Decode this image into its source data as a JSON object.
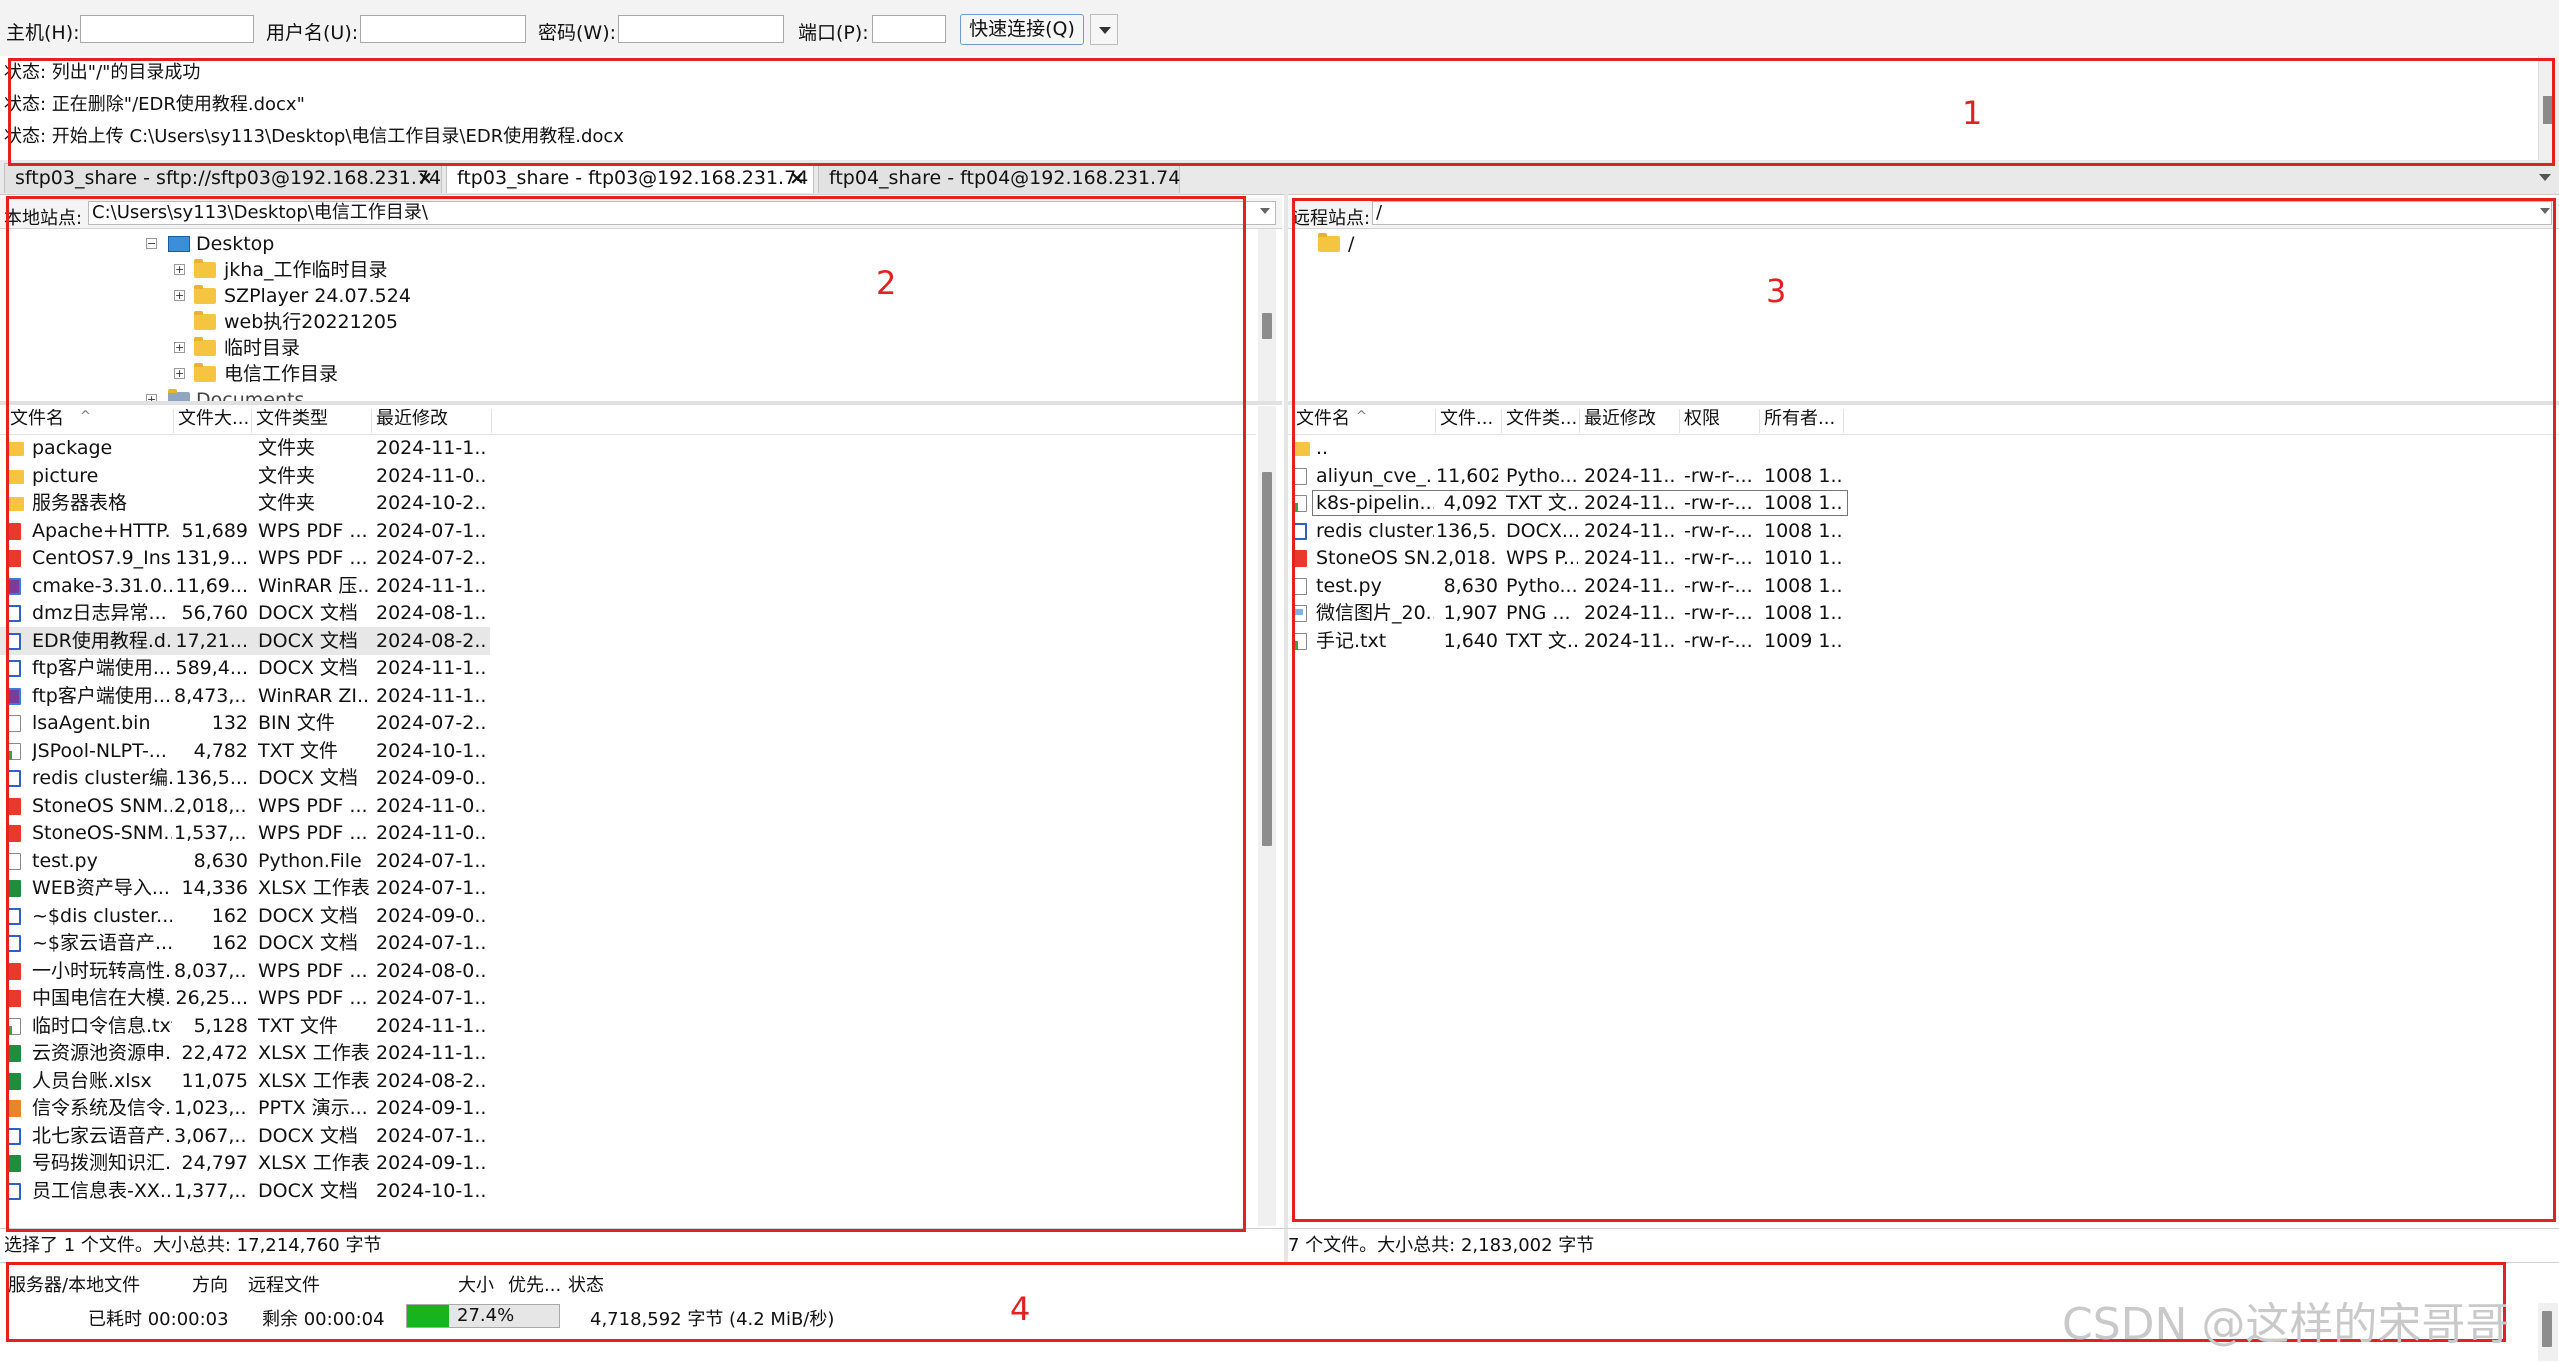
{
  "quickconnect": {
    "host_label": "主机(H):",
    "user_label": "用户名(U):",
    "password_label": "密码(W):",
    "port_label": "端口(P):",
    "connect_button": "快速连接(Q)",
    "host_value": "",
    "user_value": "",
    "password_value": "",
    "port_value": ""
  },
  "log": [
    "状态: 列出\"/\"的目录成功",
    "状态: 正在删除\"/EDR使用教程.docx\"",
    "状态: 开始上传 C:\\Users\\sy113\\Desktop\\电信工作目录\\EDR使用教程.docx"
  ],
  "tabs": [
    {
      "label": "sftp03_share - sftp://sftp03@192.168.231.74"
    },
    {
      "label": "ftp03_share - ftp03@192.168.231.74"
    },
    {
      "label": "ftp04_share - ftp04@192.168.231.74"
    }
  ],
  "local": {
    "path_label": "本地站点:",
    "path": "C:\\Users\\sy113\\Desktop\\电信工作目录\\",
    "tree": [
      {
        "label": "Desktop",
        "icon": "desktop-icon",
        "expander": "−"
      },
      {
        "label": "jkha_工作临时目录",
        "icon": "folder-icon",
        "expander": "+"
      },
      {
        "label": "SZPlayer 24.07.524",
        "icon": "folder-icon",
        "expander": "+"
      },
      {
        "label": "web执行20221205",
        "icon": "folder-icon",
        "expander": ""
      },
      {
        "label": "临时目录",
        "icon": "folder-icon",
        "expander": "+"
      },
      {
        "label": "电信工作目录",
        "icon": "folder-icon",
        "expander": "+"
      },
      {
        "label": "Documents",
        "icon": "folder-icon",
        "expander": "+"
      }
    ],
    "columns": [
      "文件名",
      "文件大...",
      "文件类型",
      "最近修改"
    ],
    "files": [
      {
        "name": "package",
        "size": "",
        "type": "文件夹",
        "modified": "2024-11-1...",
        "icon": "folder"
      },
      {
        "name": "picture",
        "size": "",
        "type": "文件夹",
        "modified": "2024-11-0...",
        "icon": "folder"
      },
      {
        "name": "服务器表格",
        "size": "",
        "type": "文件夹",
        "modified": "2024-10-2...",
        "icon": "folder"
      },
      {
        "name": "Apache+HTTP...",
        "size": "51,689",
        "type": "WPS PDF ...",
        "modified": "2024-07-1...",
        "icon": "pdf"
      },
      {
        "name": "CentOS7.9_Ins...",
        "size": "131,9...",
        "type": "WPS PDF ...",
        "modified": "2024-07-2...",
        "icon": "pdf"
      },
      {
        "name": "cmake-3.31.0....",
        "size": "11,69...",
        "type": "WinRAR 压...",
        "modified": "2024-11-1...",
        "icon": "rar"
      },
      {
        "name": "dmz日志异常...",
        "size": "56,760",
        "type": "DOCX 文档",
        "modified": "2024-08-1...",
        "icon": "docx"
      },
      {
        "name": "EDR使用教程.d...",
        "size": "17,21...",
        "type": "DOCX 文档",
        "modified": "2024-08-2...",
        "icon": "docx"
      },
      {
        "name": "ftp客户端使用...",
        "size": "589,4...",
        "type": "DOCX 文档",
        "modified": "2024-11-1...",
        "icon": "docx"
      },
      {
        "name": "ftp客户端使用...",
        "size": "8,473,...",
        "type": "WinRAR ZI...",
        "modified": "2024-11-1...",
        "icon": "rar"
      },
      {
        "name": "lsaAgent.bin",
        "size": "132",
        "type": "BIN 文件",
        "modified": "2024-07-2...",
        "icon": "bin"
      },
      {
        "name": "JSPool-NLPT-...",
        "size": "4,782",
        "type": "TXT 文件",
        "modified": "2024-10-1...",
        "icon": "txt"
      },
      {
        "name": "redis cluster编...",
        "size": "136,5...",
        "type": "DOCX 文档",
        "modified": "2024-09-0...",
        "icon": "docx"
      },
      {
        "name": "StoneOS SNM...",
        "size": "2,018,...",
        "type": "WPS PDF ...",
        "modified": "2024-11-0...",
        "icon": "pdf"
      },
      {
        "name": "StoneOS-SNM...",
        "size": "1,537,...",
        "type": "WPS PDF ...",
        "modified": "2024-11-0...",
        "icon": "pdf"
      },
      {
        "name": "test.py",
        "size": "8,630",
        "type": "Python.File",
        "modified": "2024-07-1...",
        "icon": "py"
      },
      {
        "name": "WEB资产导入...",
        "size": "14,336",
        "type": "XLSX 工作表",
        "modified": "2024-07-1...",
        "icon": "xlsx"
      },
      {
        "name": "~$dis cluster...",
        "size": "162",
        "type": "DOCX 文档",
        "modified": "2024-09-0...",
        "icon": "docx"
      },
      {
        "name": "~$家云语音产...",
        "size": "162",
        "type": "DOCX 文档",
        "modified": "2024-07-1...",
        "icon": "docx"
      },
      {
        "name": "一小时玩转高性...",
        "size": "8,037,...",
        "type": "WPS PDF ...",
        "modified": "2024-08-0...",
        "icon": "pdf"
      },
      {
        "name": "中国电信在大模...",
        "size": "26,25...",
        "type": "WPS PDF ...",
        "modified": "2024-07-1...",
        "icon": "pdf"
      },
      {
        "name": "临时口令信息.txt",
        "size": "5,128",
        "type": "TXT 文件",
        "modified": "2024-11-1...",
        "icon": "txt"
      },
      {
        "name": "云资源池资源申...",
        "size": "22,472",
        "type": "XLSX 工作表",
        "modified": "2024-11-1...",
        "icon": "xlsx"
      },
      {
        "name": "人员台账.xlsx",
        "size": "11,075",
        "type": "XLSX 工作表",
        "modified": "2024-08-2...",
        "icon": "xlsx"
      },
      {
        "name": "信令系统及信令...",
        "size": "1,023,...",
        "type": "PPTX 演示...",
        "modified": "2024-09-1...",
        "icon": "pptx"
      },
      {
        "name": "北七家云语音产...",
        "size": "3,067,...",
        "type": "DOCX 文档",
        "modified": "2024-07-1...",
        "icon": "docx"
      },
      {
        "name": "号码拨测知识汇...",
        "size": "24,797",
        "type": "XLSX 工作表",
        "modified": "2024-09-1...",
        "icon": "xlsx"
      },
      {
        "name": "员工信息表-XX...",
        "size": "1,377,...",
        "type": "DOCX 文档",
        "modified": "2024-10-1...",
        "icon": "docx"
      }
    ],
    "selected_row": 7,
    "status": "选择了 1 个文件。大小总共: 17,214,760 字节"
  },
  "remote": {
    "path_label": "远程站点:",
    "path": "/",
    "tree": [
      {
        "label": "/",
        "icon": "folder-icon"
      }
    ],
    "columns": [
      "文件名",
      "文件...",
      "文件类...",
      "最近修改",
      "权限",
      "所有者..."
    ],
    "files": [
      {
        "name": "..",
        "size": "",
        "type": "",
        "modified": "",
        "perm": "",
        "owner": "",
        "icon": "folder"
      },
      {
        "name": "aliyun_cve_...",
        "size": "11,602",
        "type": "Pytho...",
        "modified": "2024-11...",
        "perm": "-rw-r-...",
        "owner": "1008 1...",
        "icon": "py"
      },
      {
        "name": "k8s-pipelin...",
        "size": "4,092",
        "type": "TXT 文...",
        "modified": "2024-11...",
        "perm": "-rw-r-...",
        "owner": "1008 1...",
        "icon": "txt"
      },
      {
        "name": "redis cluster...",
        "size": "136,5...",
        "type": "DOCX...",
        "modified": "2024-11...",
        "perm": "-rw-r-...",
        "owner": "1008 1...",
        "icon": "docx"
      },
      {
        "name": "StoneOS SN...",
        "size": "2,018...",
        "type": "WPS P...",
        "modified": "2024-11...",
        "perm": "-rw-r-...",
        "owner": "1010 1...",
        "icon": "pdf"
      },
      {
        "name": "test.py",
        "size": "8,630",
        "type": "Pytho...",
        "modified": "2024-11...",
        "perm": "-rw-r-...",
        "owner": "1008 1...",
        "icon": "py"
      },
      {
        "name": "微信图片_20...",
        "size": "1,907",
        "type": "PNG ...",
        "modified": "2024-11...",
        "perm": "-rw-r-...",
        "owner": "1008 1...",
        "icon": "png"
      },
      {
        "name": "手记.txt",
        "size": "1,640",
        "type": "TXT 文...",
        "modified": "2024-11...",
        "perm": "-rw-r-...",
        "owner": "1009 1...",
        "icon": "txt"
      }
    ],
    "focused_row": 2,
    "status": "7 个文件。大小总共: 2,183,002 字节"
  },
  "queue": {
    "columns": [
      "服务器/本地文件",
      "方向",
      "远程文件",
      "大小",
      "优先...",
      "状态"
    ],
    "elapsed": "已耗时 00:00:03",
    "remaining": "剩余 00:00:04",
    "progress_percent": 27.4,
    "progress_label": "27.4%",
    "transferred": "4,718,592 字节 (4.2 MiB/秒)"
  },
  "annotations": [
    "1",
    "2",
    "3",
    "4"
  ],
  "watermark": "CSDN @这样的宋哥哥",
  "colors": {
    "annotation": "#e42121",
    "progress": "#18b41e"
  }
}
